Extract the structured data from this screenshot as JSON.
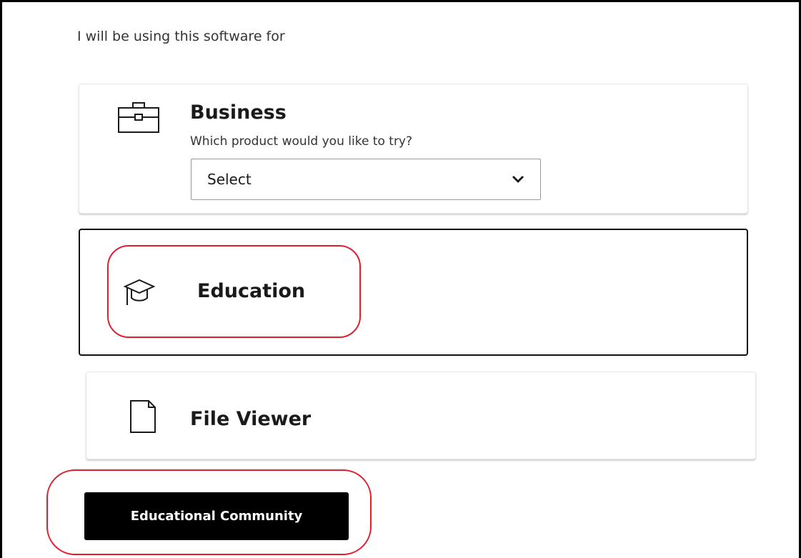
{
  "prompt": "I will be using this software for",
  "options": {
    "business": {
      "title": "Business",
      "question": "Which product would you like to try?",
      "select_value": "Select",
      "icon": "briefcase-icon"
    },
    "education": {
      "title": "Education",
      "icon": "graduation-cap-icon",
      "selected": true
    },
    "file_viewer": {
      "title": "File Viewer",
      "icon": "document-icon"
    }
  },
  "cta": {
    "label": "Educational Community"
  },
  "colors": {
    "highlight": "#e02030",
    "button_bg": "#000000",
    "button_text": "#ffffff",
    "selected_border": "#111111"
  }
}
